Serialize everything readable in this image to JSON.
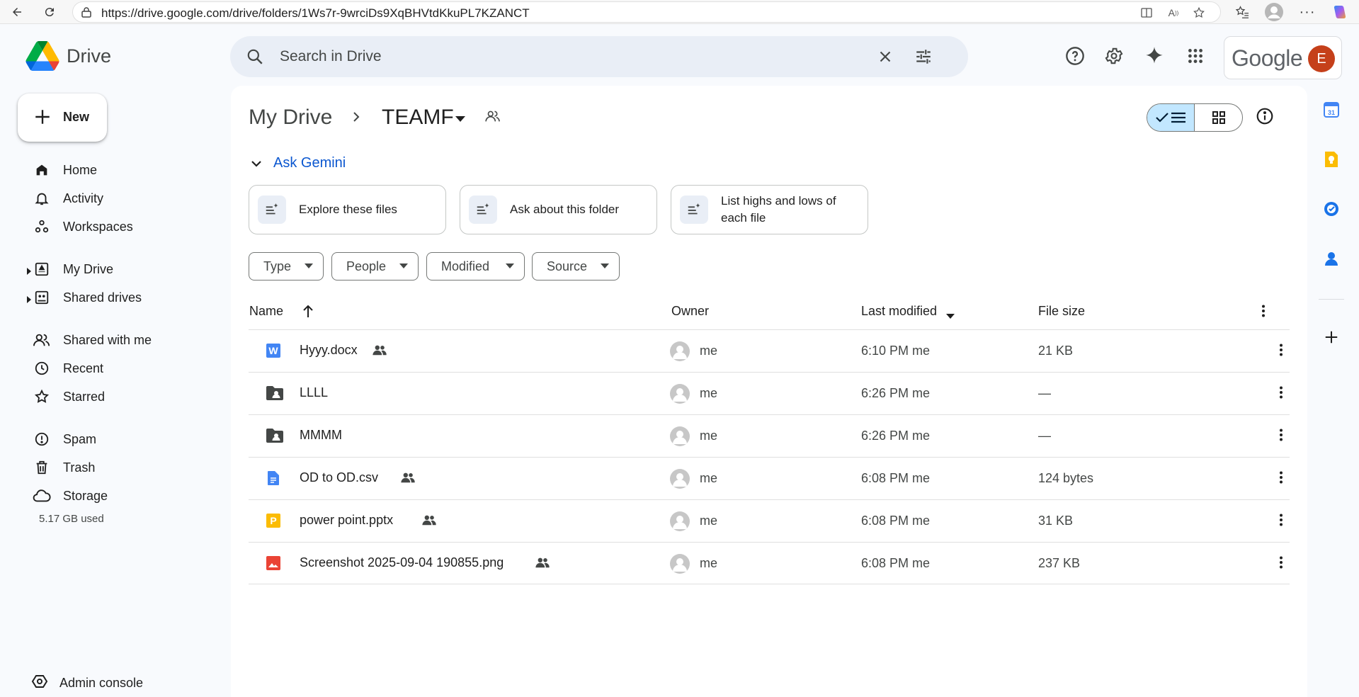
{
  "browser": {
    "url": "https://drive.google.com/drive/folders/1Ws7r-9wrciDs9XqBHVtdKkuPL7KZANCT"
  },
  "app": {
    "name": "Drive",
    "brand_colors": [
      "#4285f4",
      "#34a853",
      "#fbbc04",
      "#ea4335"
    ]
  },
  "search": {
    "placeholder": "Search in Drive"
  },
  "account": {
    "brand": "Google",
    "avatar_initial": "E",
    "avatar_color": "#c5401a"
  },
  "sidebar": {
    "new_label": "New",
    "items": [
      {
        "label": "Home",
        "icon": "home-icon"
      },
      {
        "label": "Activity",
        "icon": "bell-icon"
      },
      {
        "label": "Workspaces",
        "icon": "workspaces-icon"
      },
      {
        "label": "My Drive",
        "icon": "my-drive-icon"
      },
      {
        "label": "Shared drives",
        "icon": "shared-drives-icon"
      },
      {
        "label": "Shared with me",
        "icon": "people-icon"
      },
      {
        "label": "Recent",
        "icon": "clock-icon"
      },
      {
        "label": "Starred",
        "icon": "star-icon"
      },
      {
        "label": "Spam",
        "icon": "spam-icon"
      },
      {
        "label": "Trash",
        "icon": "trash-icon"
      },
      {
        "label": "Storage",
        "icon": "cloud-icon"
      }
    ],
    "storage_used": "5.17 GB used",
    "admin_label": "Admin console"
  },
  "breadcrumb": {
    "root": "My Drive",
    "current": "TEAMF"
  },
  "gemini": {
    "label": "Ask Gemini",
    "suggestions": [
      "Explore these files",
      "Ask about this folder",
      "List highs and lows of each file"
    ]
  },
  "filters": [
    "Type",
    "People",
    "Modified",
    "Source"
  ],
  "table": {
    "columns": {
      "name": "Name",
      "owner": "Owner",
      "modified": "Last modified",
      "size": "File size"
    },
    "rows": [
      {
        "name": "Hyyy.docx",
        "type": "docx",
        "shared": true,
        "owner": "me",
        "modified": "6:10 PM me",
        "size": "21 KB"
      },
      {
        "name": "LLLL",
        "type": "shared-folder",
        "shared": false,
        "owner": "me",
        "modified": "6:26 PM me",
        "size": "—"
      },
      {
        "name": "MMMM",
        "type": "shared-folder",
        "shared": false,
        "owner": "me",
        "modified": "6:26 PM me",
        "size": "—"
      },
      {
        "name": "OD to OD.csv",
        "type": "csv",
        "shared": true,
        "owner": "me",
        "modified": "6:08 PM me",
        "size": "124 bytes"
      },
      {
        "name": "power point.pptx",
        "type": "pptx",
        "shared": true,
        "owner": "me",
        "modified": "6:08 PM me",
        "size": "31 KB"
      },
      {
        "name": "Screenshot 2025-09-04 190855.png",
        "type": "png",
        "shared": true,
        "owner": "me",
        "modified": "6:08 PM me",
        "size": "237 KB"
      }
    ]
  },
  "right_rail": [
    "calendar-icon",
    "keep-icon",
    "tasks-icon",
    "contacts-icon",
    "add-icon"
  ]
}
